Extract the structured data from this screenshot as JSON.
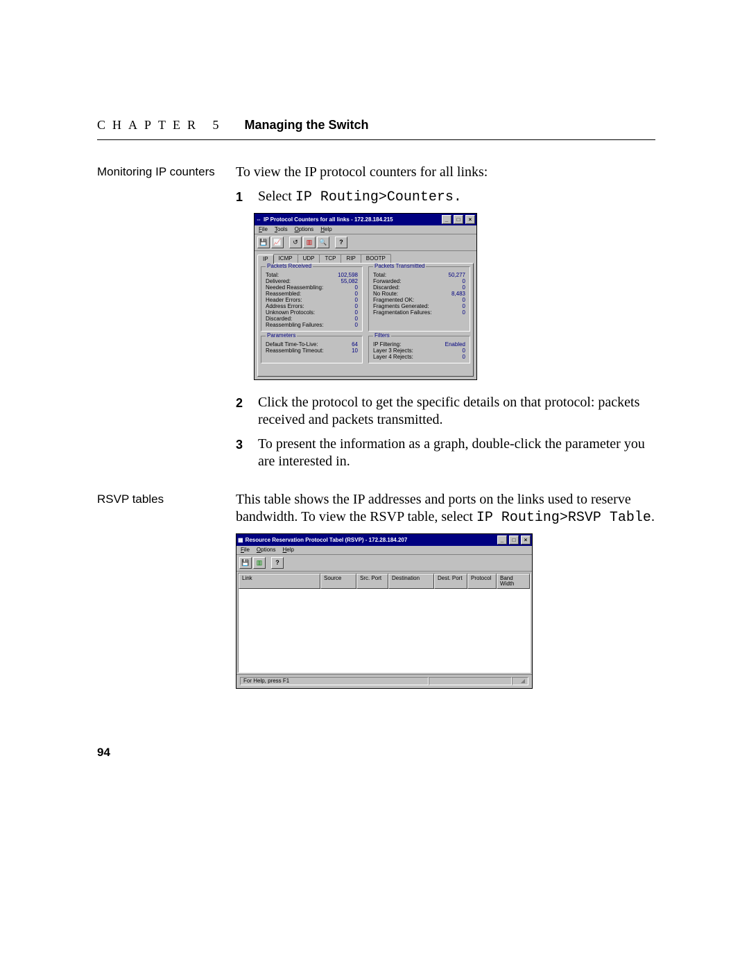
{
  "header": {
    "chapter": "CHAPTER 5",
    "title": "Managing the Switch"
  },
  "section1": {
    "side": "Monitoring IP counters",
    "intro": "To view the IP protocol counters for all links:",
    "step1_pre": "Select ",
    "step1_code": "IP Routing>Counters.",
    "step2": "Click the protocol to get the specific details on that protocol: packets received and packets transmitted.",
    "step3": "To present the information as a graph, double-click the parameter you are interested in."
  },
  "section2": {
    "side": "RSVP tables",
    "para_pre": "This table shows the IP addresses and ports on the links used to reserve bandwidth. To view the RSVP table, select ",
    "para_code": "IP Routing>RSVP Table",
    "para_post": "."
  },
  "win1": {
    "title": "IP Protocol Counters for all links - 172.28.184.215",
    "menu": {
      "file": "File",
      "tools": "Tools",
      "options": "Options",
      "help": "Help"
    },
    "tabs": [
      "IP",
      "ICMP",
      "UDP",
      "TCP",
      "RIP",
      "BOOTP"
    ],
    "groups": {
      "recv": {
        "title": "Packets Received",
        "rows": [
          [
            "Total:",
            "102,598"
          ],
          [
            "Delivered:",
            "55,082"
          ],
          [
            "Needed Reassembling:",
            "0"
          ],
          [
            "Reassembled:",
            "0"
          ],
          [
            "Header Errors:",
            "0"
          ],
          [
            "Address Errors:",
            "0"
          ],
          [
            "Unknown Protocols:",
            "0"
          ],
          [
            "Discarded:",
            "0"
          ],
          [
            "Reassembling Failures:",
            "0"
          ]
        ]
      },
      "trans": {
        "title": "Packets Transmitted",
        "rows": [
          [
            "Total:",
            "50,277"
          ],
          [
            "Forwarded:",
            "0"
          ],
          [
            "Discarded:",
            "0"
          ],
          [
            "No Route:",
            "8,483"
          ],
          [
            "Fragmented OK:",
            "0"
          ],
          [
            "Fragments Generated:",
            "0"
          ],
          [
            "Fragmentation Failures:",
            "0"
          ]
        ]
      },
      "params": {
        "title": "Parameters",
        "rows": [
          [
            "Default Time-To-Live:",
            "64"
          ],
          [
            "Reassembling Timeout:",
            "10"
          ]
        ]
      },
      "filters": {
        "title": "Filters",
        "rows": [
          [
            "IP Filtering:",
            "Enabled"
          ],
          [
            "Layer 3 Rejects:",
            "0"
          ],
          [
            "Layer 4 Rejects:",
            "0"
          ]
        ]
      }
    }
  },
  "win2": {
    "title": "Resource Reservation Protocol Tabel (RSVP) - 172.28.184.207",
    "menu": {
      "file": "File",
      "options": "Options",
      "help": "Help"
    },
    "cols": [
      "Link",
      "Source",
      "Src. Port",
      "Destination",
      "Dest. Port",
      "Protocol",
      "Band Width"
    ],
    "status": "For Help, press F1"
  },
  "page": "94"
}
